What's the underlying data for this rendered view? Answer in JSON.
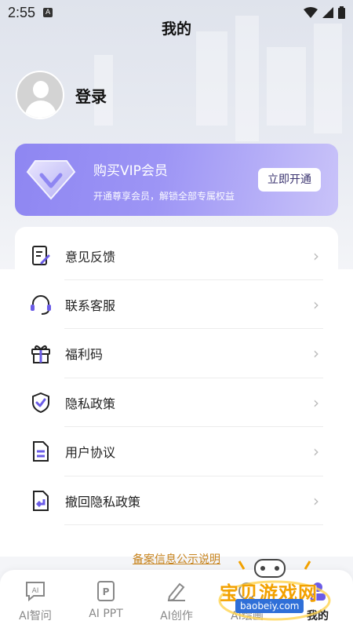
{
  "status": {
    "time": "2:55",
    "notif_icon": "A"
  },
  "header": {
    "title": "我的"
  },
  "profile": {
    "login_label": "登录",
    "avatar_icon": "default-avatar-icon"
  },
  "vip": {
    "title": "购买VIP会员",
    "subtitle": "开通尊享会员，解锁全部专属权益",
    "button": "立即开通",
    "gradient_start": "#8e86f2",
    "gradient_end": "#c9c3f9"
  },
  "menu": {
    "items": [
      {
        "label": "意见反馈",
        "icon": "feedback-icon"
      },
      {
        "label": "联系客服",
        "icon": "headset-icon"
      },
      {
        "label": "福利码",
        "icon": "gift-icon"
      },
      {
        "label": "隐私政策",
        "icon": "shield-check-icon"
      },
      {
        "label": "用户协议",
        "icon": "document-icon"
      },
      {
        "label": "撤回隐私政策",
        "icon": "revoke-document-icon"
      }
    ]
  },
  "footer": {
    "record_link": "备案信息公示说明"
  },
  "tabs": [
    {
      "label": "AI智问",
      "icon": "ai-chat-icon"
    },
    {
      "label": "AI PPT",
      "icon": "ppt-icon"
    },
    {
      "label": "AI创作",
      "icon": "pen-icon"
    },
    {
      "label": "AI绘画",
      "icon": "paint-icon"
    },
    {
      "label": "我的",
      "icon": "profile-icon",
      "active": true
    }
  ],
  "watermark": {
    "text": "宝贝游戏网",
    "url": "baobeiy.com"
  },
  "colors": {
    "accent": "#6b5ce7",
    "link": "#c7831c",
    "chevron": "#bbbbbb"
  }
}
